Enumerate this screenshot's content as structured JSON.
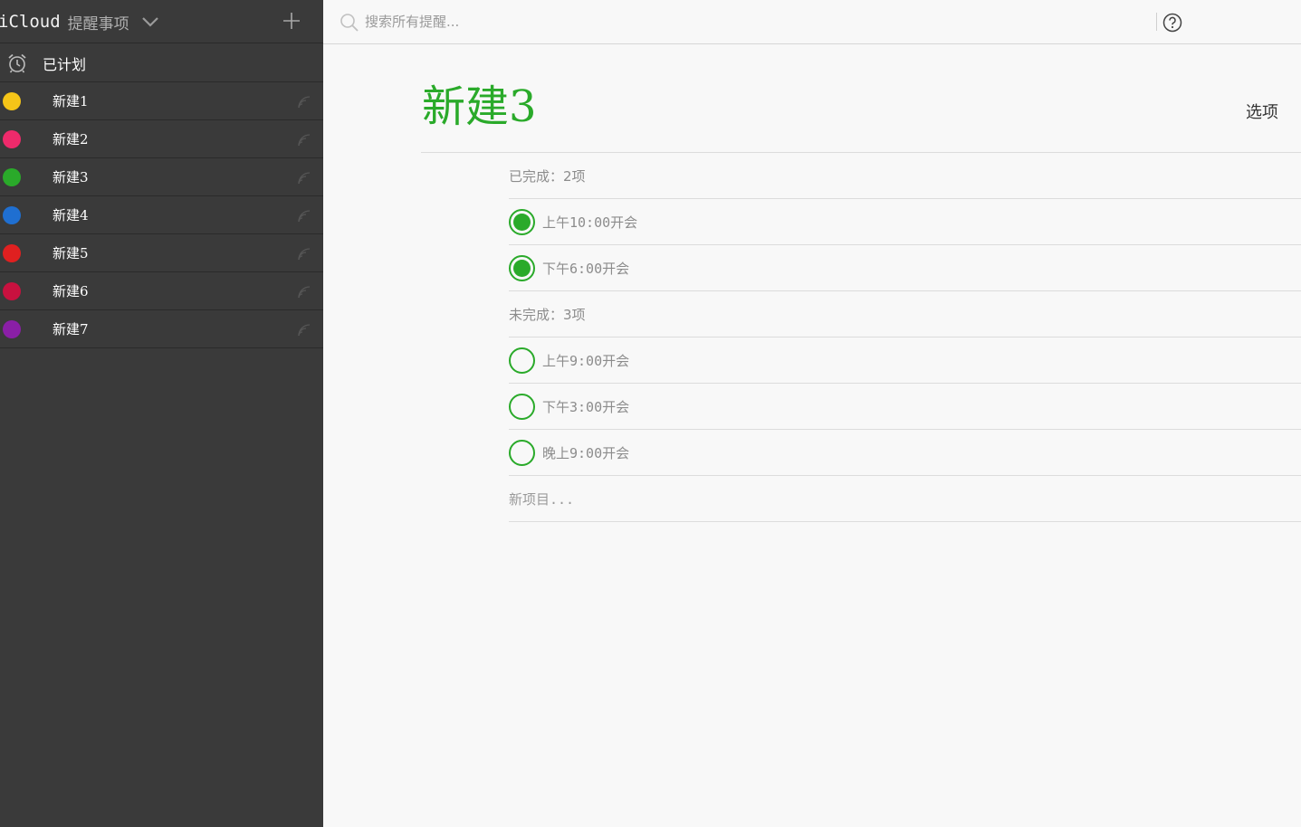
{
  "sidebar": {
    "brand": "iCloud",
    "app_name": "提醒事项",
    "chevron_icon": "chevron-down-icon",
    "add_icon": "plus-icon",
    "scheduled": {
      "label": "已计划",
      "icon": "alarm-clock-icon"
    },
    "lists": [
      {
        "label": "新建1",
        "color": "#f5c518"
      },
      {
        "label": "新建2",
        "color": "#ee2a6b"
      },
      {
        "label": "新建3",
        "color": "#2aaa2a"
      },
      {
        "label": "新建4",
        "color": "#1f6fd1"
      },
      {
        "label": "新建5",
        "color": "#e02020"
      },
      {
        "label": "新建6",
        "color": "#c8113f"
      },
      {
        "label": "新建7",
        "color": "#8a1fa6"
      }
    ]
  },
  "topbar": {
    "search_placeholder": "搜索所有提醒...",
    "search_icon": "search-icon",
    "help_icon": "question-icon"
  },
  "main": {
    "title": "新建3",
    "title_color": "#2aaa2a",
    "options_label": "选项",
    "completed_label": "已完成：2项",
    "completed": [
      {
        "text": "上午10:00开会"
      },
      {
        "text": "下午6:00开会"
      }
    ],
    "incomplete_label": "未完成：3项",
    "incomplete": [
      {
        "text": "上午9:00开会"
      },
      {
        "text": "下午3:00开会"
      },
      {
        "text": "晚上9:00开会"
      }
    ],
    "new_item_label": "新项目..."
  }
}
